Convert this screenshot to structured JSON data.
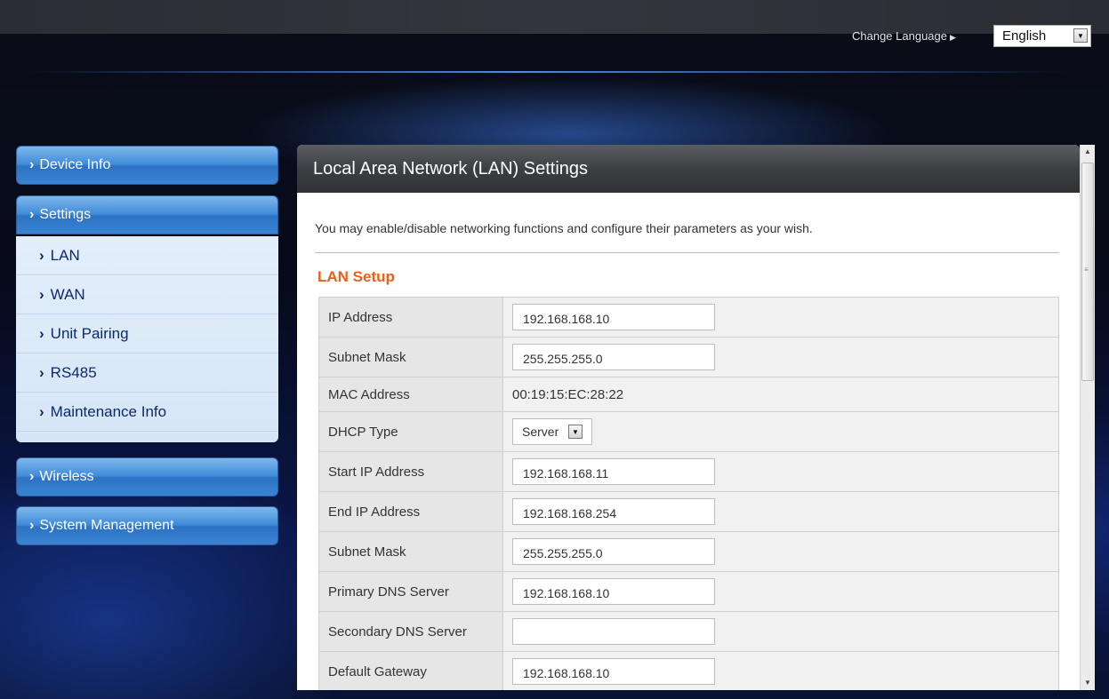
{
  "header": {
    "change_language_label": "Change Language",
    "language_value": "English"
  },
  "sidebar": {
    "items": [
      {
        "label": "Device Info"
      },
      {
        "label": "Settings"
      },
      {
        "label": "Wireless"
      },
      {
        "label": "System Management"
      }
    ],
    "sub_items": [
      {
        "label": "LAN"
      },
      {
        "label": "WAN"
      },
      {
        "label": "Unit Pairing"
      },
      {
        "label": "RS485"
      },
      {
        "label": "Maintenance Info"
      }
    ]
  },
  "main": {
    "title": "Local Area Network (LAN) Settings",
    "description": "You may enable/disable networking functions and configure their parameters as your wish.",
    "section_title": "LAN Setup",
    "rows": [
      {
        "label": "IP Address",
        "value": "192.168.168.10"
      },
      {
        "label": "Subnet Mask",
        "value": "255.255.255.0"
      },
      {
        "label": "MAC Address",
        "value": "00:19:15:EC:28:22"
      },
      {
        "label": "DHCP Type",
        "value": "Server"
      },
      {
        "label": "Start IP Address",
        "value": "192.168.168.11"
      },
      {
        "label": "End IP Address",
        "value": "192.168.168.254"
      },
      {
        "label": "Subnet Mask",
        "value": "255.255.255.0"
      },
      {
        "label": "Primary DNS Server",
        "value": "192.168.168.10"
      },
      {
        "label": "Secondary DNS Server",
        "value": ""
      },
      {
        "label": "Default Gateway",
        "value": "192.168.168.10"
      }
    ]
  },
  "colors": {
    "accent_orange": "#e8601b",
    "sidebar_blue": "#3f8ad8",
    "header_dark": "#3d3f43"
  },
  "icons": {
    "chevron": "chevron-right-icon",
    "dropdown": "dropdown-arrow-icon"
  }
}
